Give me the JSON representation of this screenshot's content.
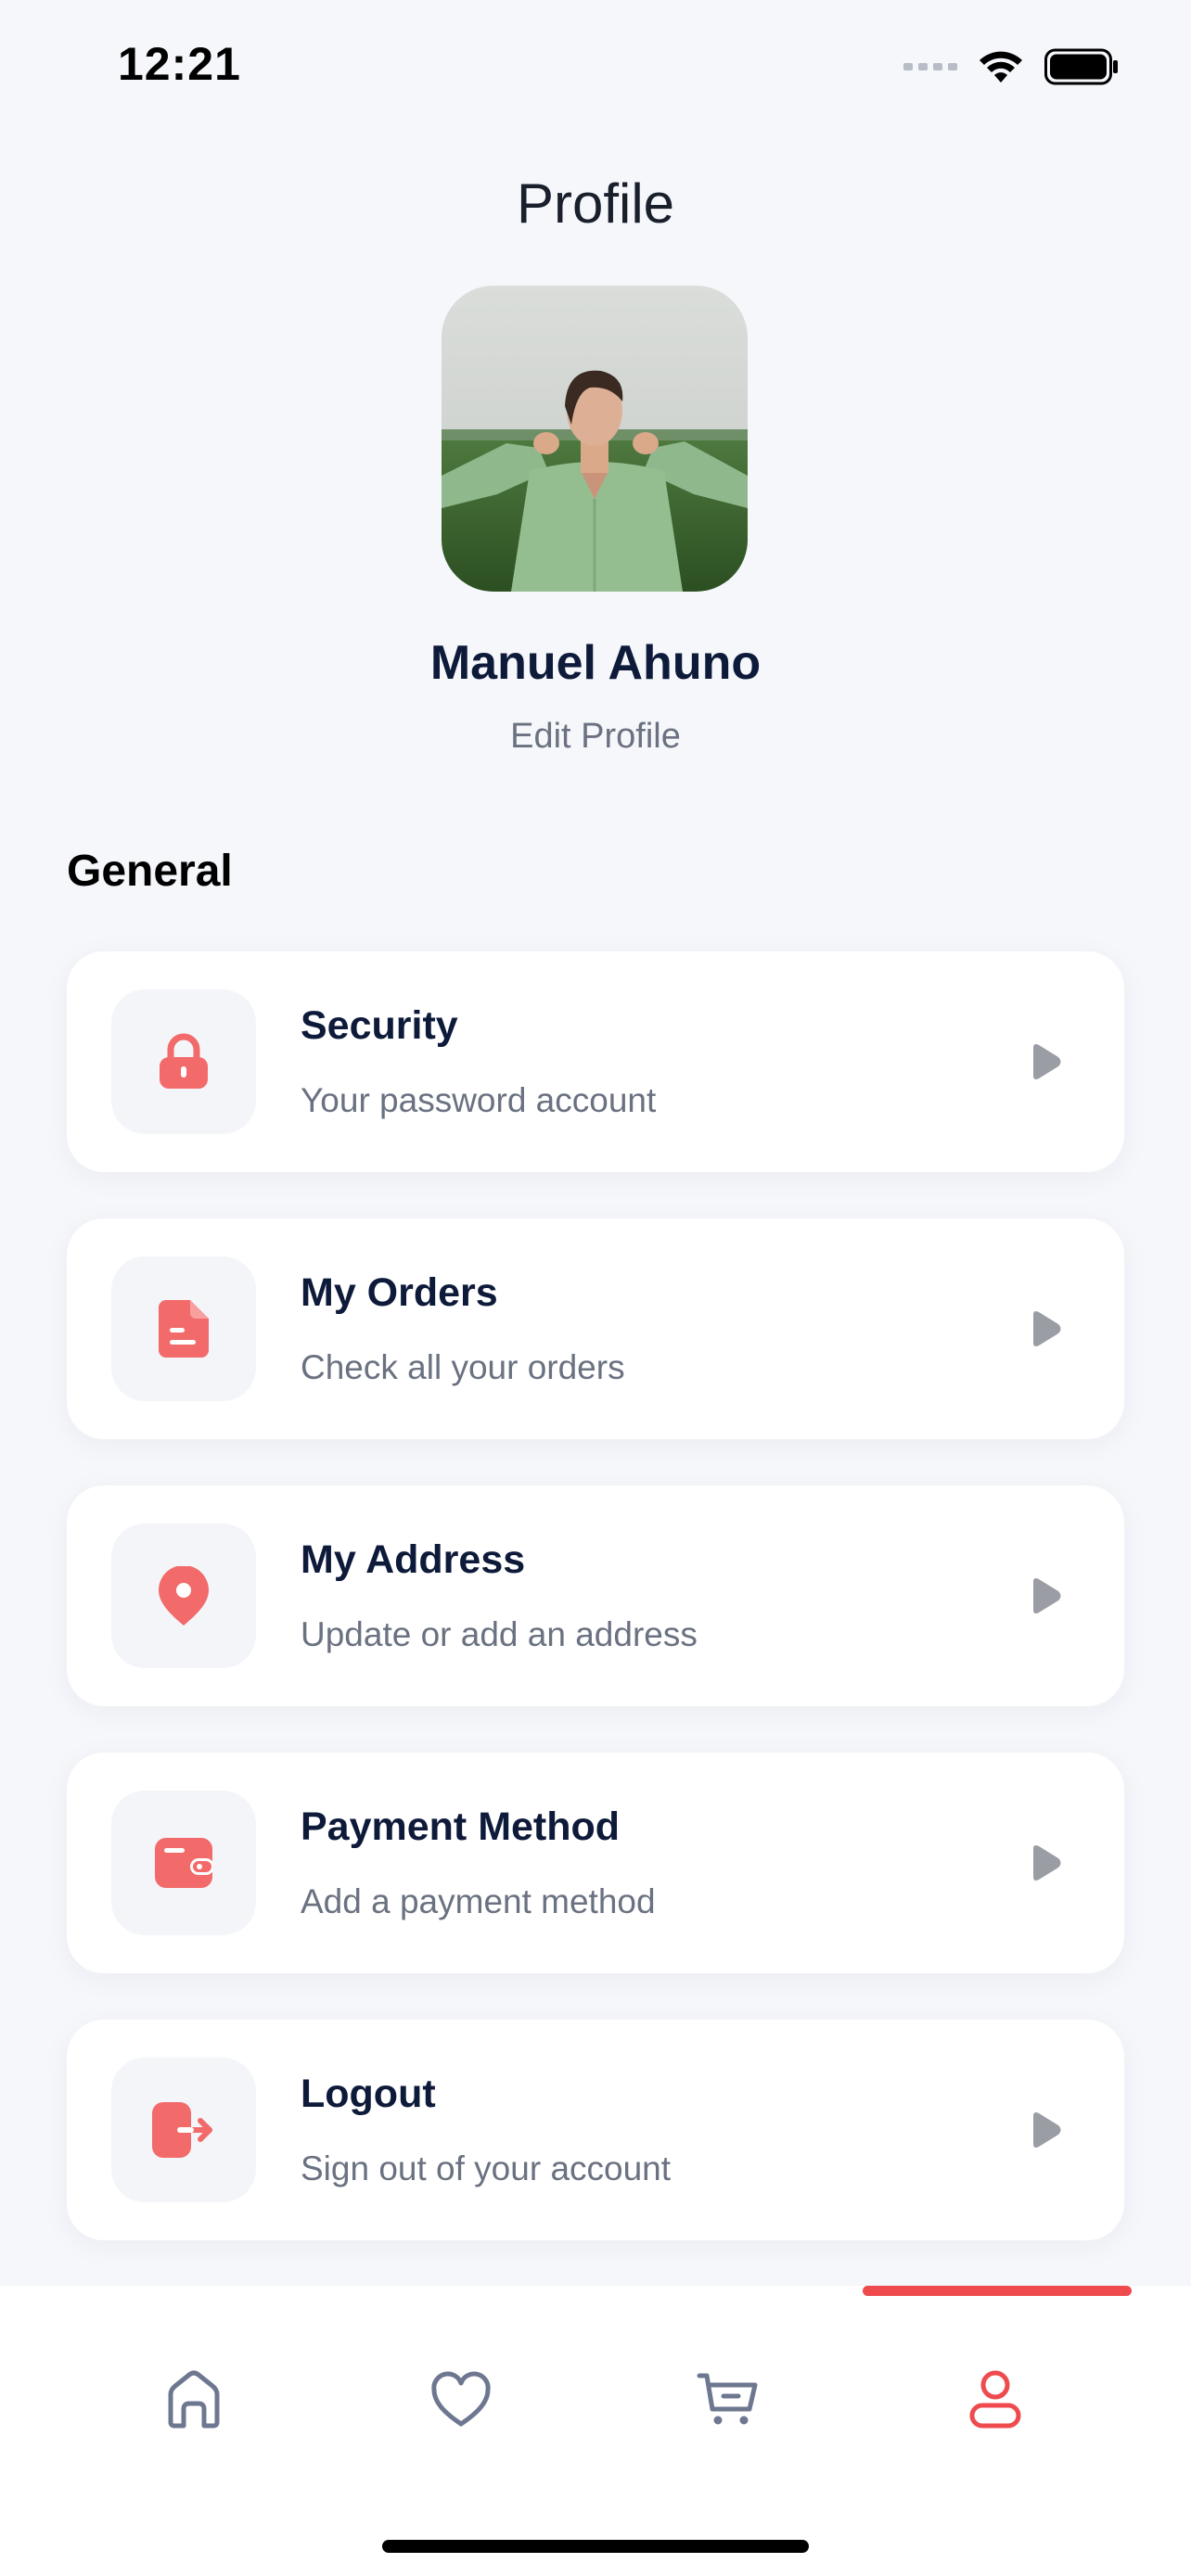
{
  "status_bar": {
    "time": "12:21"
  },
  "header": {
    "title": "Profile"
  },
  "profile": {
    "name": "Manuel Ahuno",
    "edit_label": "Edit Profile"
  },
  "section": {
    "title": "General"
  },
  "menu": [
    {
      "title": "Security",
      "subtitle": "Your password account",
      "icon": "lock-icon"
    },
    {
      "title": "My Orders",
      "subtitle": "Check all your orders",
      "icon": "document-icon"
    },
    {
      "title": "My Address",
      "subtitle": "Update or add an address",
      "icon": "location-pin-icon"
    },
    {
      "title": "Payment Method",
      "subtitle": "Add a payment method",
      "icon": "wallet-icon"
    },
    {
      "title": "Logout",
      "subtitle": "Sign out of your account",
      "icon": "logout-icon"
    }
  ],
  "bottom_nav": {
    "items": [
      "home-icon",
      "heart-icon",
      "cart-icon",
      "profile-icon"
    ],
    "active": "profile"
  },
  "colors": {
    "accent": "#EF4A4E",
    "icon_red": "#F26A6A",
    "text_dark": "#0E1A3A",
    "text_muted": "#6A7180",
    "background": "#F6F7FB"
  }
}
